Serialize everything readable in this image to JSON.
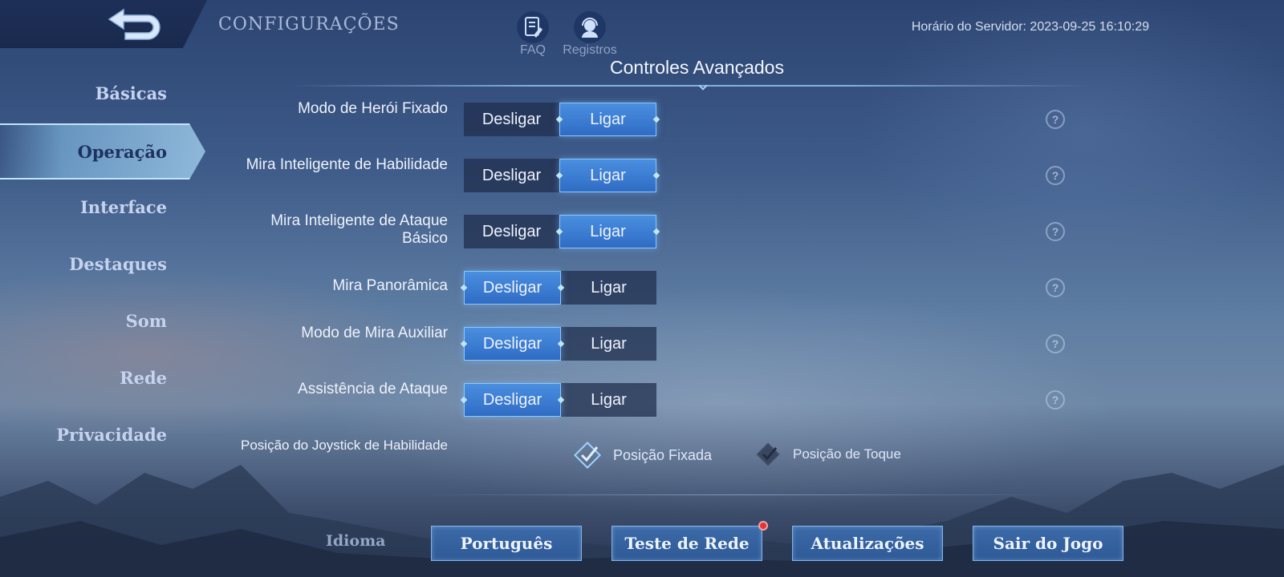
{
  "header": {
    "title": "CONFIGURAÇÕES",
    "server_time": "Horário do Servidor: 2023-09-25 16:10:29",
    "faq_label": "FAQ",
    "records_label": "Registros"
  },
  "sidebar": {
    "items": [
      {
        "label": "Básicas"
      },
      {
        "label": "Operação",
        "active": true
      },
      {
        "label": "Interface"
      },
      {
        "label": "Destaques"
      },
      {
        "label": "Som"
      },
      {
        "label": "Rede"
      },
      {
        "label": "Privacidade"
      }
    ]
  },
  "section": {
    "title": "Controles Avançados"
  },
  "toggle_options": {
    "off": "Desligar",
    "on": "Ligar"
  },
  "settings": [
    {
      "label": "Modo de Herói Fixado",
      "value": "Ligar"
    },
    {
      "label": "Mira Inteligente de Habilidade",
      "value": "Ligar"
    },
    {
      "label": "Mira Inteligente de Ataque Básico",
      "value": "Ligar"
    },
    {
      "label": "Mira Panorâmica",
      "value": "Desligar"
    },
    {
      "label": "Modo de Mira Auxiliar",
      "value": "Desligar"
    },
    {
      "label": "Assistência de Ataque",
      "value": "Desligar"
    }
  ],
  "help_glyph": "?",
  "joystick": {
    "label": "Posição do Joystick de Habilidade",
    "options": [
      {
        "label": "Posição Fixada",
        "selected": true
      },
      {
        "label": "Posição de Toque",
        "selected": false
      }
    ]
  },
  "footer": {
    "language_label": "Idioma",
    "buttons": [
      "Português",
      "Teste de Rede",
      "Atualizações",
      "Sair do Jogo"
    ]
  },
  "colors": {
    "accent": "#3d7fd6",
    "active_tab": "#9fd0f3",
    "notification": "#e3343a"
  }
}
